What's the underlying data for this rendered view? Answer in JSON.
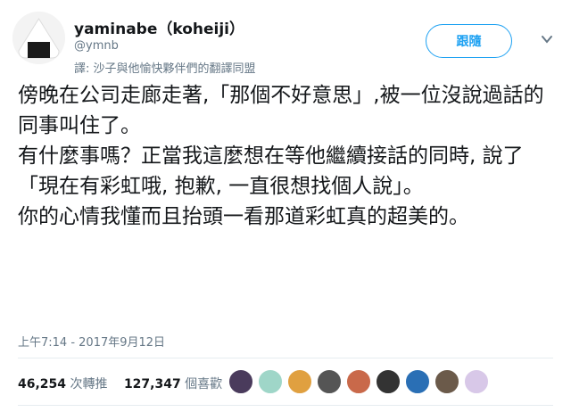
{
  "author": {
    "display_name": "yaminabe（koheiji）",
    "handle": "@ymnb",
    "translation_note": "譯: 沙子與他愉快夥伴們的翻譯同盟"
  },
  "follow_button": {
    "label": "跟隨"
  },
  "tweet": {
    "text": "傍晚在公司走廊走著,「那個不好意思」,被一位沒說過話的同事叫住了。\n有什麼事嗎？正當我這麼想在等他繼續接話的同時, 說了「現在有彩虹哦, 抱歉, 一直很想找個人說」。\n你的心情我懂而且抬頭一看那道彩虹真的超美的。",
    "timestamp": "上午7:14 - 2017年9月12日"
  },
  "stats": {
    "retweets_count": "46,254",
    "retweets_label": "次轉推",
    "likes_count": "127,347",
    "likes_label": "個喜歡"
  },
  "likers": [
    {
      "name": "liker-avatar-1",
      "color": "#4a3b5c"
    },
    {
      "name": "liker-avatar-2",
      "color": "#9fd6c8"
    },
    {
      "name": "liker-avatar-3",
      "color": "#e0a040"
    },
    {
      "name": "liker-avatar-4",
      "color": "#555555"
    },
    {
      "name": "liker-avatar-5",
      "color": "#c9694a"
    },
    {
      "name": "liker-avatar-6",
      "color": "#333333"
    },
    {
      "name": "liker-avatar-7",
      "color": "#2a6fb5"
    },
    {
      "name": "liker-avatar-8",
      "color": "#6b5a4a"
    },
    {
      "name": "liker-avatar-9",
      "color": "#d8c8e8"
    }
  ],
  "colors": {
    "accent": "#1da1f2",
    "muted": "#657786",
    "text": "#14171a"
  }
}
